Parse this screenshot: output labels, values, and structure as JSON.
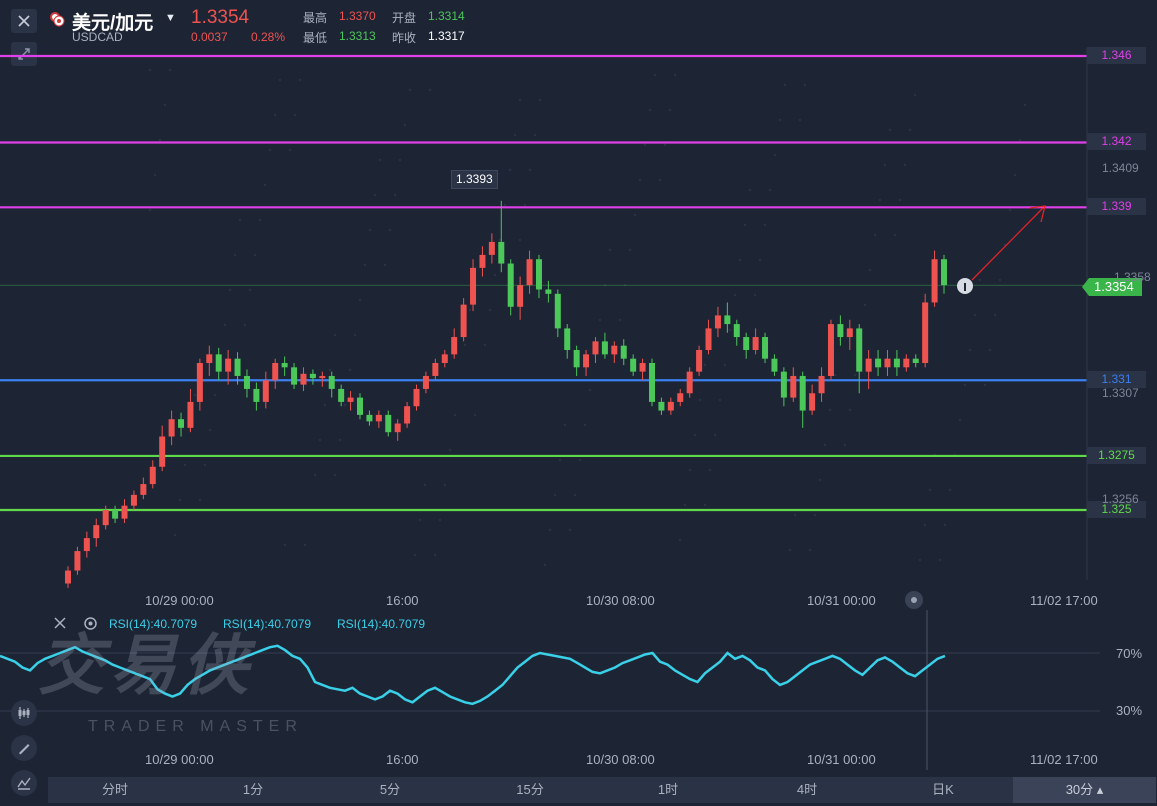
{
  "header": {
    "symbol": "美元/加元",
    "code": "USDCAD",
    "price": "1.3354",
    "change": "0.0037",
    "change_pct": "0.28%",
    "high_label": "最高",
    "high": "1.3370",
    "open_label": "开盘",
    "open": "1.3314",
    "low_label": "最低",
    "low": "1.3313",
    "prev_label": "昨收",
    "prev": "1.3317"
  },
  "price_axis": {
    "hlines": [
      {
        "label": "1.346",
        "color": "#e040e8"
      },
      {
        "label": "1.342",
        "color": "#e040e8"
      },
      {
        "label": "1.339",
        "color": "#e040e8"
      },
      {
        "label": "1.331",
        "color": "#3b7ff0"
      },
      {
        "label": "1.3275",
        "color": "#5fd94a"
      },
      {
        "label": "1.325",
        "color": "#5fd94a"
      }
    ],
    "faint_ticks": [
      "1.3409",
      "1.3358",
      "1.3307",
      "1.3256"
    ],
    "current": "1.3354",
    "peak_label": "1.3393"
  },
  "x_axis": [
    "10/29 00:00",
    "16:00",
    "10/30 08:00",
    "10/31 00:00",
    "11/02 17:00"
  ],
  "rsi": {
    "labels": [
      "RSI(14):40.7079",
      "RSI(14):40.7079",
      "RSI(14):40.7079"
    ],
    "levels": [
      "70%",
      "30%"
    ],
    "color": "#39d0e8"
  },
  "watermark": {
    "cn": "交易侠",
    "en": "TRADER MASTER"
  },
  "timeframes": [
    "分时",
    "1分",
    "5分",
    "15分",
    "1时",
    "4时",
    "日K",
    "30分"
  ],
  "active_timeframe": "30分",
  "colors": {
    "up": "#ef5350",
    "down": "#4cc75a",
    "bg": "#1d2434"
  },
  "chart_data": {
    "type": "candlestick",
    "ylim": [
      1.3215,
      1.3485
    ],
    "candles": [
      [
        1.3216,
        1.3222,
        1.3214,
        1.3224
      ],
      [
        1.3222,
        1.3231,
        1.322,
        1.3233
      ],
      [
        1.3231,
        1.3237,
        1.3228,
        1.324
      ],
      [
        1.3237,
        1.3243,
        1.3233,
        1.3246
      ],
      [
        1.3243,
        1.325,
        1.3241,
        1.3252
      ],
      [
        1.325,
        1.3246,
        1.3244,
        1.3252
      ],
      [
        1.3246,
        1.3252,
        1.3244,
        1.3255
      ],
      [
        1.3252,
        1.3257,
        1.325,
        1.3259
      ],
      [
        1.3257,
        1.3262,
        1.3255,
        1.3265
      ],
      [
        1.3262,
        1.327,
        1.326,
        1.3273
      ],
      [
        1.327,
        1.3284,
        1.3268,
        1.3289
      ],
      [
        1.3284,
        1.3292,
        1.328,
        1.3296
      ],
      [
        1.3292,
        1.3288,
        1.3284,
        1.3295
      ],
      [
        1.3288,
        1.33,
        1.3286,
        1.3306
      ],
      [
        1.33,
        1.3318,
        1.3296,
        1.332
      ],
      [
        1.3318,
        1.3322,
        1.3312,
        1.3326
      ],
      [
        1.3322,
        1.3314,
        1.331,
        1.3325
      ],
      [
        1.3314,
        1.332,
        1.3308,
        1.3324
      ],
      [
        1.332,
        1.3312,
        1.3308,
        1.3323
      ],
      [
        1.3312,
        1.3306,
        1.3302,
        1.3315
      ],
      [
        1.3306,
        1.33,
        1.3296,
        1.3309
      ],
      [
        1.33,
        1.331,
        1.3297,
        1.3314
      ],
      [
        1.331,
        1.3318,
        1.3306,
        1.332
      ],
      [
        1.3318,
        1.3316,
        1.3312,
        1.3321
      ],
      [
        1.3316,
        1.3308,
        1.3306,
        1.3318
      ],
      [
        1.3308,
        1.3313,
        1.3305,
        1.3316
      ],
      [
        1.3313,
        1.3311,
        1.3308,
        1.3315
      ],
      [
        1.3311,
        1.3312,
        1.3307,
        1.3314
      ],
      [
        1.3312,
        1.3306,
        1.3302,
        1.3314
      ],
      [
        1.3306,
        1.33,
        1.3298,
        1.3308
      ],
      [
        1.33,
        1.3302,
        1.3296,
        1.3305
      ],
      [
        1.3302,
        1.3294,
        1.3292,
        1.3304
      ],
      [
        1.3294,
        1.3291,
        1.3289,
        1.3296
      ],
      [
        1.3291,
        1.3294,
        1.3288,
        1.3296
      ],
      [
        1.3294,
        1.3286,
        1.3284,
        1.3296
      ],
      [
        1.3286,
        1.329,
        1.3282,
        1.3292
      ],
      [
        1.329,
        1.3298,
        1.3288,
        1.33
      ],
      [
        1.3298,
        1.3306,
        1.3296,
        1.3308
      ],
      [
        1.3306,
        1.3312,
        1.3304,
        1.3314
      ],
      [
        1.3312,
        1.3318,
        1.331,
        1.332
      ],
      [
        1.3318,
        1.3322,
        1.3316,
        1.3324
      ],
      [
        1.3322,
        1.333,
        1.332,
        1.3334
      ],
      [
        1.333,
        1.3345,
        1.3328,
        1.3348
      ],
      [
        1.3345,
        1.3362,
        1.3342,
        1.3366
      ],
      [
        1.3362,
        1.3368,
        1.3358,
        1.3372
      ],
      [
        1.3368,
        1.3374,
        1.3364,
        1.3378
      ],
      [
        1.3374,
        1.3364,
        1.336,
        1.3393
      ],
      [
        1.3364,
        1.3344,
        1.334,
        1.3366
      ],
      [
        1.3344,
        1.3354,
        1.3338,
        1.3358
      ],
      [
        1.3354,
        1.3366,
        1.335,
        1.337
      ],
      [
        1.3366,
        1.3352,
        1.3348,
        1.3368
      ],
      [
        1.3352,
        1.335,
        1.3346,
        1.3356
      ],
      [
        1.335,
        1.3334,
        1.333,
        1.3352
      ],
      [
        1.3334,
        1.3324,
        1.332,
        1.3336
      ],
      [
        1.3324,
        1.3316,
        1.3312,
        1.3326
      ],
      [
        1.3316,
        1.3322,
        1.3312,
        1.3324
      ],
      [
        1.3322,
        1.3328,
        1.3318,
        1.333
      ],
      [
        1.3328,
        1.3322,
        1.332,
        1.3332
      ],
      [
        1.3322,
        1.3326,
        1.3318,
        1.3328
      ],
      [
        1.3326,
        1.332,
        1.3317,
        1.3329
      ],
      [
        1.332,
        1.3314,
        1.3312,
        1.3322
      ],
      [
        1.3314,
        1.3318,
        1.331,
        1.332
      ],
      [
        1.3318,
        1.33,
        1.3298,
        1.332
      ],
      [
        1.33,
        1.3296,
        1.3294,
        1.3302
      ],
      [
        1.3296,
        1.33,
        1.3294,
        1.3302
      ],
      [
        1.33,
        1.3304,
        1.3298,
        1.3306
      ],
      [
        1.3304,
        1.3314,
        1.3302,
        1.3316
      ],
      [
        1.3314,
        1.3324,
        1.3312,
        1.3326
      ],
      [
        1.3324,
        1.3334,
        1.3322,
        1.3338
      ],
      [
        1.3334,
        1.334,
        1.333,
        1.3344
      ],
      [
        1.334,
        1.3336,
        1.3332,
        1.3346
      ],
      [
        1.3336,
        1.333,
        1.3326,
        1.3338
      ],
      [
        1.333,
        1.3324,
        1.332,
        1.3332
      ],
      [
        1.3324,
        1.333,
        1.3322,
        1.3334
      ],
      [
        1.333,
        1.332,
        1.3318,
        1.3332
      ],
      [
        1.332,
        1.3314,
        1.3312,
        1.3322
      ],
      [
        1.3314,
        1.3302,
        1.3298,
        1.3316
      ],
      [
        1.3302,
        1.3312,
        1.33,
        1.3316
      ],
      [
        1.3312,
        1.3296,
        1.3288,
        1.3314
      ],
      [
        1.3296,
        1.3304,
        1.3294,
        1.3308
      ],
      [
        1.3304,
        1.3312,
        1.33,
        1.3316
      ],
      [
        1.3312,
        1.3336,
        1.331,
        1.3338
      ],
      [
        1.3336,
        1.333,
        1.3326,
        1.334
      ],
      [
        1.333,
        1.3334,
        1.3324,
        1.3338
      ],
      [
        1.3334,
        1.3314,
        1.3304,
        1.3336
      ],
      [
        1.3314,
        1.332,
        1.3306,
        1.3324
      ],
      [
        1.332,
        1.3316,
        1.3312,
        1.3324
      ],
      [
        1.3316,
        1.332,
        1.3312,
        1.3324
      ],
      [
        1.332,
        1.3316,
        1.3312,
        1.3324
      ],
      [
        1.3316,
        1.332,
        1.3314,
        1.3322
      ],
      [
        1.332,
        1.3318,
        1.3316,
        1.3322
      ],
      [
        1.3318,
        1.3346,
        1.3316,
        1.335
      ],
      [
        1.3346,
        1.3366,
        1.3344,
        1.337
      ],
      [
        1.3366,
        1.3354,
        1.335,
        1.3368
      ]
    ],
    "rsi_values": [
      68,
      66,
      64,
      60,
      58,
      63,
      66,
      68,
      70,
      72,
      74,
      71,
      69,
      67,
      65,
      62,
      60,
      58,
      56,
      54,
      52,
      45,
      42,
      40,
      42,
      48,
      52,
      55,
      58,
      60,
      62,
      64,
      66,
      68,
      70,
      72,
      74,
      75,
      72,
      68,
      66,
      60,
      50,
      48,
      46,
      45,
      44,
      46,
      42,
      40,
      38,
      40,
      44,
      42,
      38,
      36,
      40,
      44,
      46,
      43,
      40,
      38,
      36,
      35,
      37,
      40,
      44,
      48,
      54,
      60,
      64,
      68,
      70,
      69,
      68,
      67,
      66,
      63,
      60,
      57,
      56,
      58,
      60,
      63,
      65,
      67,
      69,
      70,
      64,
      62,
      58,
      55,
      52,
      50,
      56,
      60,
      64,
      70,
      66,
      68,
      65,
      60,
      58,
      52,
      48,
      50,
      54,
      58,
      62,
      64,
      66,
      68,
      66,
      62,
      58,
      55,
      60,
      65,
      67,
      64,
      60,
      56,
      54,
      58,
      62,
      66,
      68
    ]
  }
}
